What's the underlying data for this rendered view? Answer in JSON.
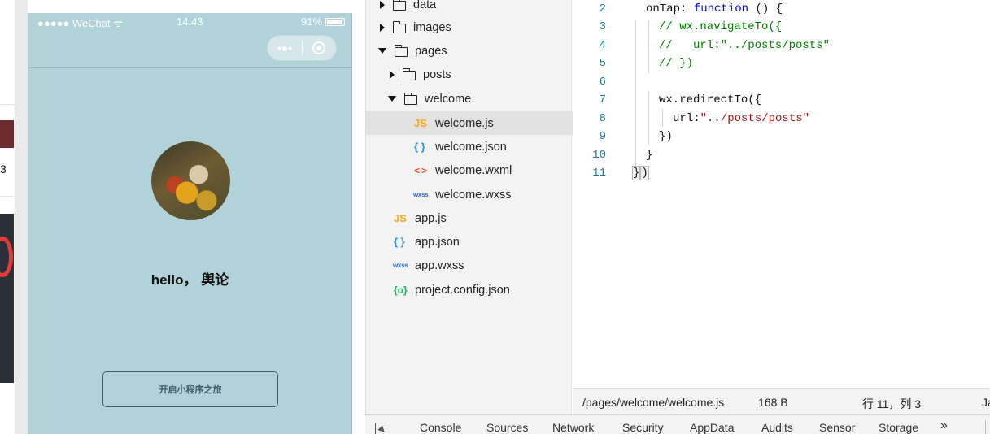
{
  "phone": {
    "carrier": "●●●●● WeChat",
    "wifi": "ᯤ",
    "time": "14:43",
    "battery_pct": "91%",
    "capsule_menu": "•●•",
    "greeting": "hello， 舆论",
    "start_button": "开启小程序之旅"
  },
  "left_strip": {
    "fragment": "3"
  },
  "tree": {
    "data": "data",
    "images": "images",
    "pages": "pages",
    "posts": "posts",
    "welcome": "welcome",
    "welcome_js": "welcome.js",
    "welcome_json": "welcome.json",
    "welcome_wxml": "welcome.wxml",
    "welcome_wxss": "welcome.wxss",
    "app_js": "app.js",
    "app_json": "app.json",
    "app_wxss": "app.wxss",
    "project_config": "project.config.json",
    "icon_js": "JS",
    "icon_json": "{ }",
    "icon_wxml": "<>",
    "icon_wxss": "wxss",
    "icon_config": "{o}"
  },
  "editor": {
    "line_numbers": [
      "2",
      "3",
      "4",
      "5",
      "6",
      "7",
      "8",
      "9",
      "10",
      "11"
    ],
    "l2_a": "onTap: ",
    "l2_b": "function",
    "l2_c": " () {",
    "l3": "// wx.navigateTo({",
    "l4": "//   url:\"../posts/posts\"",
    "l5": "// })",
    "l7": "wx.redirectTo({",
    "l8_a": "url:",
    "l8_b": "\"../posts/posts\"",
    "l9": "})",
    "l10": "}",
    "l11_a": "}",
    "l11_b": ")"
  },
  "status": {
    "path": "/pages/welcome/welcome.js",
    "size": "168 B",
    "position": "行 11，列 3",
    "lang": "Ja"
  },
  "devtools": {
    "tabs": [
      "Console",
      "Sources",
      "Network",
      "Security",
      "AppData",
      "Audits",
      "Sensor",
      "Storage"
    ],
    "more": "»"
  }
}
